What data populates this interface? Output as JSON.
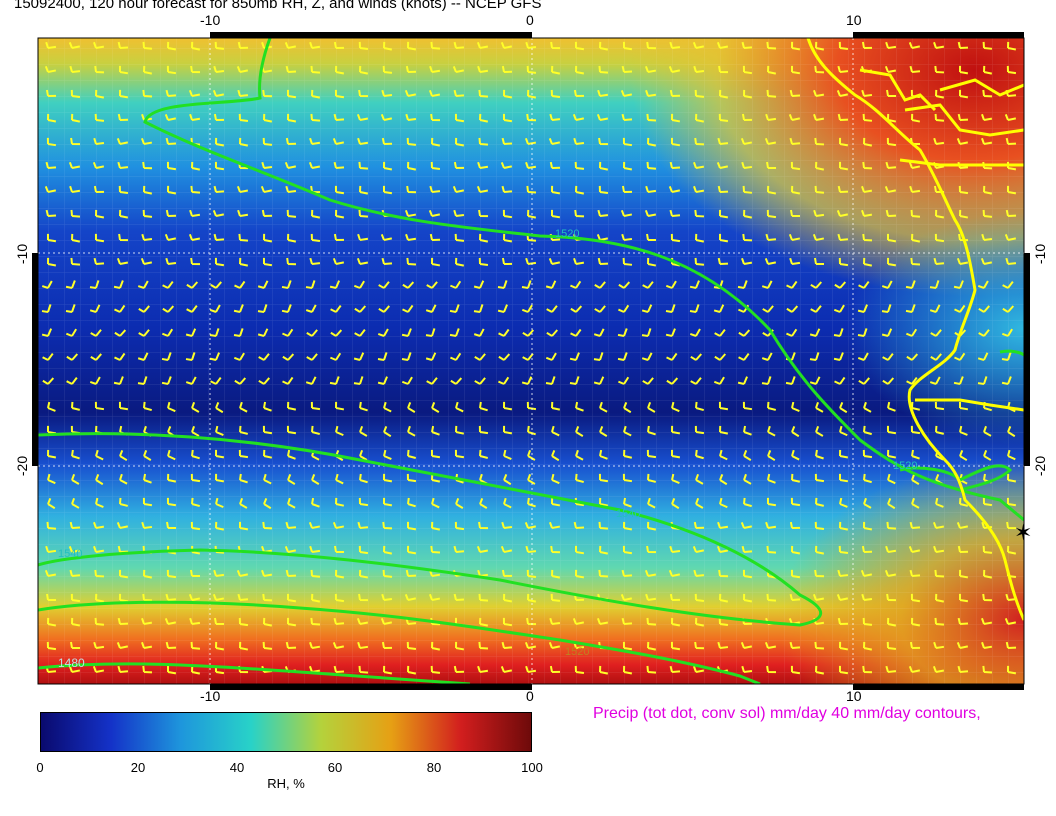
{
  "title": "15092400, 120 hour forecast for 850mb RH, Z, and winds (knots)  -- NCEP GFS",
  "axes": {
    "x_ticks_top": [
      "-10",
      "0",
      "10"
    ],
    "x_ticks_bottom": [
      "-10",
      "0",
      "10"
    ],
    "y_ticks_left": [
      "-10",
      "-20"
    ],
    "y_ticks_right": [
      "-10",
      "-20"
    ]
  },
  "contour_labels": [
    "1520",
    "1520",
    "1540",
    "1540",
    "1480",
    "1520"
  ],
  "colorbar": {
    "labels": [
      "0",
      "20",
      "40",
      "60",
      "80",
      "100"
    ],
    "title": "RH, %",
    "colors": [
      "#0a0a6e",
      "#1432c8",
      "#1e96dc",
      "#28d2c8",
      "#b4d23c",
      "#e6a014",
      "#d21e1e",
      "#6e0a0a"
    ]
  },
  "precip_note": "Precip (tot dot, conv sol) mm/day 40 mm/day contours,",
  "colors": {
    "contour": "#22e022",
    "barb": "#ffff28",
    "coast": "#ffff00",
    "precip_text": "#e000e0"
  }
}
